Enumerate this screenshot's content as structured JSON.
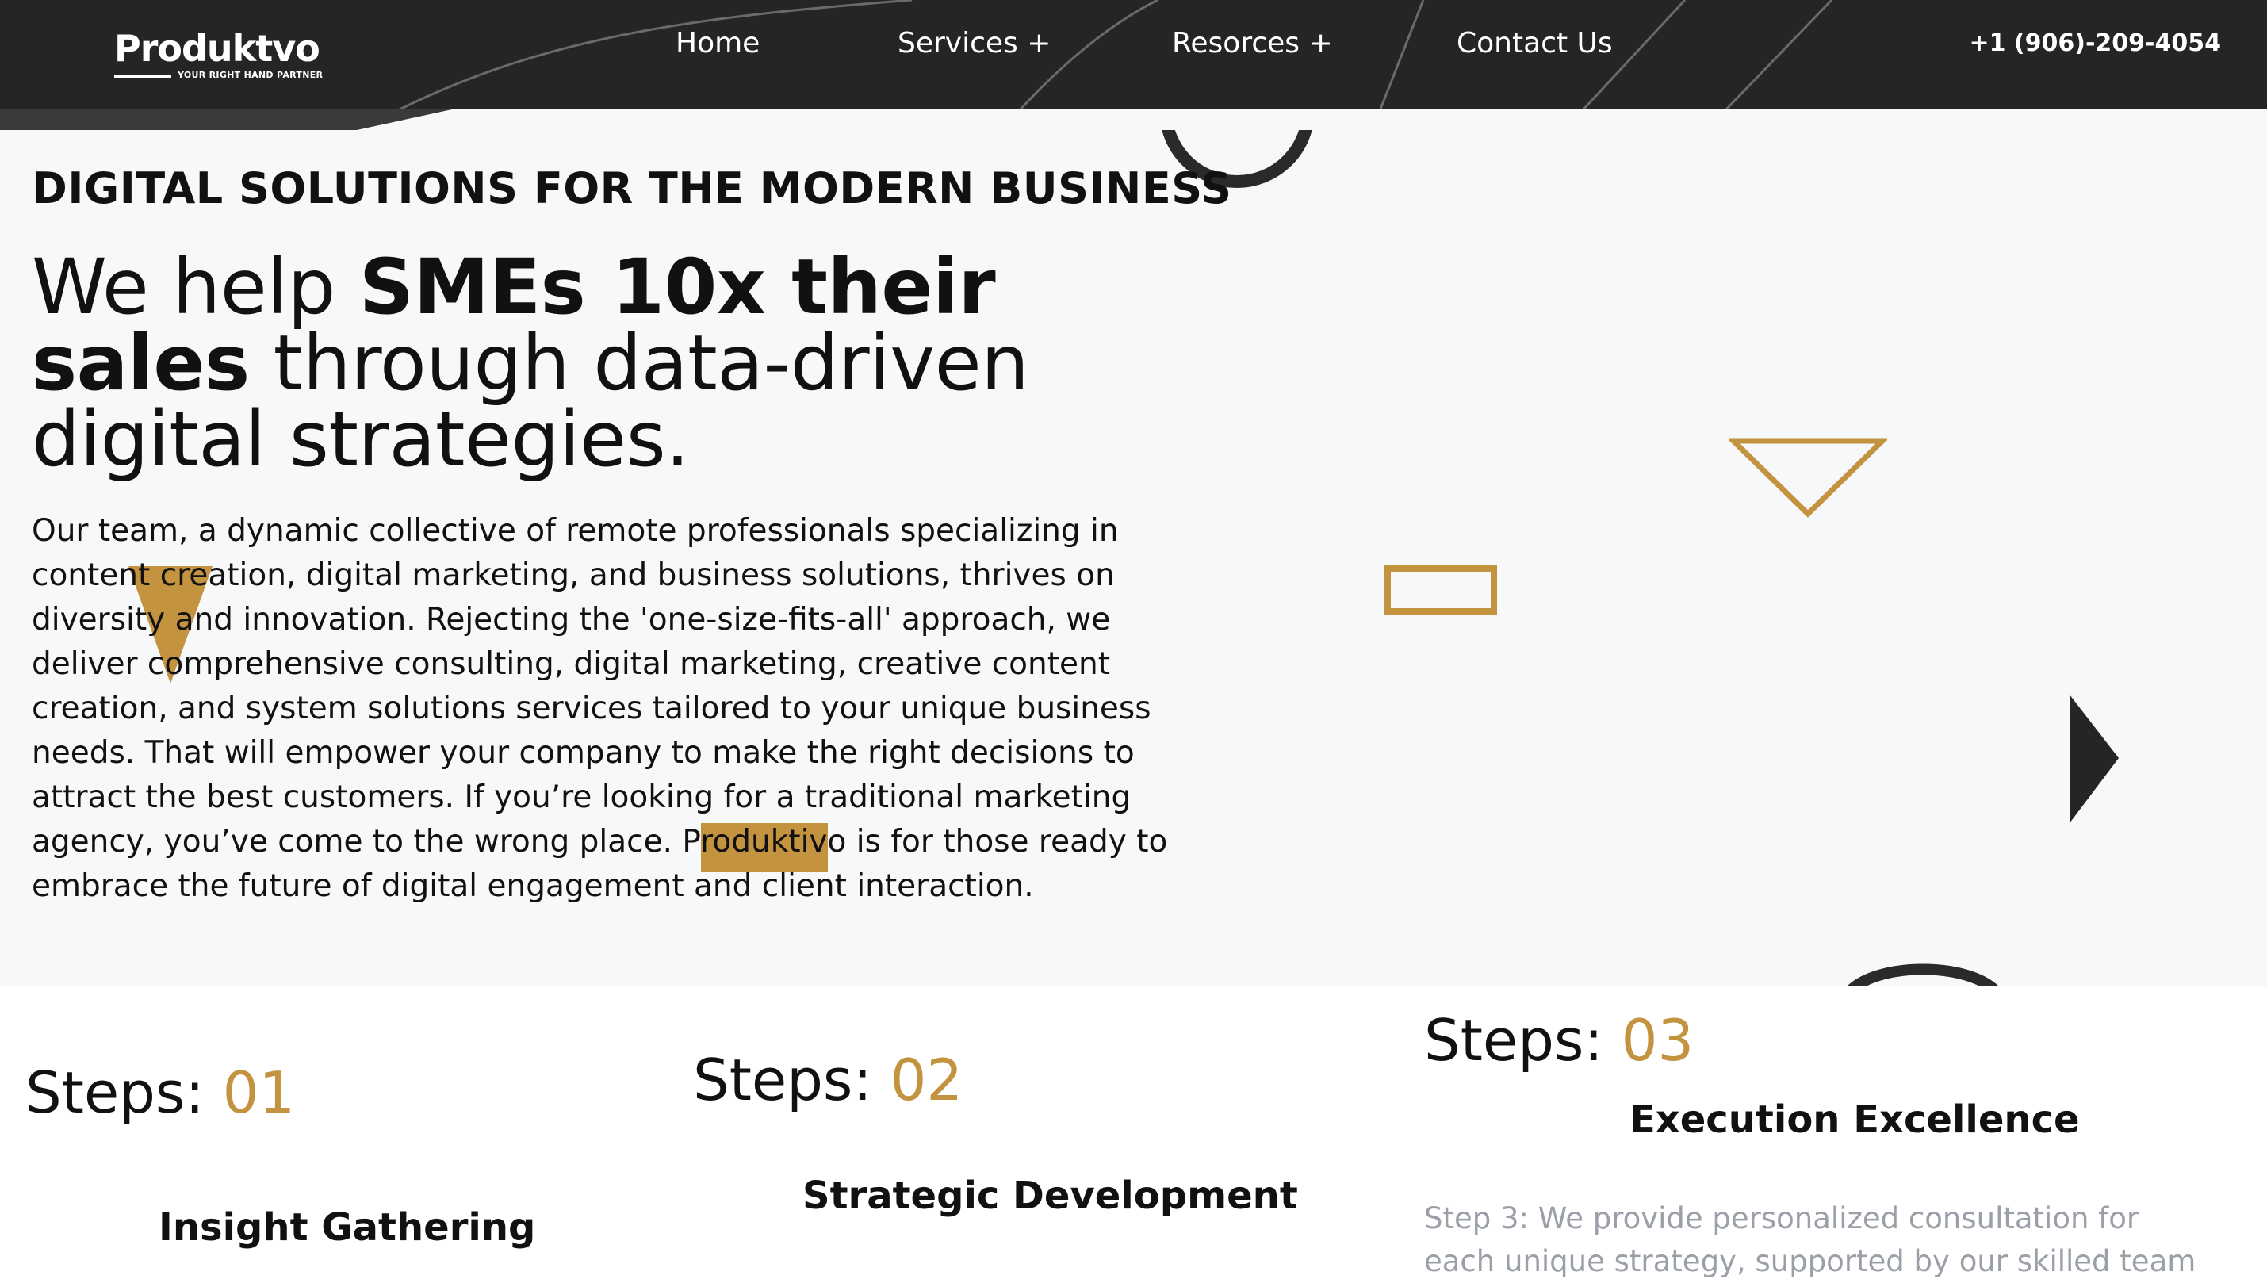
{
  "header": {
    "logo": {
      "name": "Produktvo",
      "tagline": "YOUR RIGHT HAND PARTNER"
    },
    "nav": [
      {
        "label": "Home"
      },
      {
        "label": "Services +"
      },
      {
        "label": "Resorces +"
      },
      {
        "label": "Contact Us"
      }
    ],
    "phone": "+1 (906)-209-4054"
  },
  "hero": {
    "kicker": "DIGITAL SOLUTIONS FOR THE MODERN BUSINESS",
    "headline": {
      "part1": "We help ",
      "bold1": "SMEs 10x their sales",
      "part2": " through data-driven digital strategies."
    },
    "body": "Our team, a dynamic collective of remote professionals specializing in content creation, digital marketing, and business solutions, thrives on diversity and innovation. Rejecting the 'one-size-fits-all' approach, we deliver comprehensive consulting, digital marketing, creative content creation, and system solutions services tailored to your unique business needs. That will empower your company to make the right decisions to attract the best customers. If you’re looking for a traditional marketing agency, you’ve come to the wrong place. Produktivo is for those ready to embrace the future of digital engagement and client interaction."
  },
  "steps": [
    {
      "prefix": "Steps: ",
      "number": "01",
      "title": "Insight Gathering",
      "description": ""
    },
    {
      "prefix": "Steps: ",
      "number": "02",
      "title": "Strategic Development",
      "description": ""
    },
    {
      "prefix": "Steps: ",
      "number": "03",
      "title": "Execution Excellence",
      "description": "Step 3: We provide personalized consultation for each unique strategy, supported by our skilled team"
    }
  ],
  "colors": {
    "accent_gold": "#c39340",
    "header_bg": "#252525",
    "hero_bg": "#f7f8fa",
    "muted_text": "#9a9fa8"
  },
  "icons": [
    "triangle-outline-icon",
    "rectangle-outline-icon",
    "triangle-filled-icon",
    "play-triangle-icon",
    "ring-arc-icon"
  ]
}
